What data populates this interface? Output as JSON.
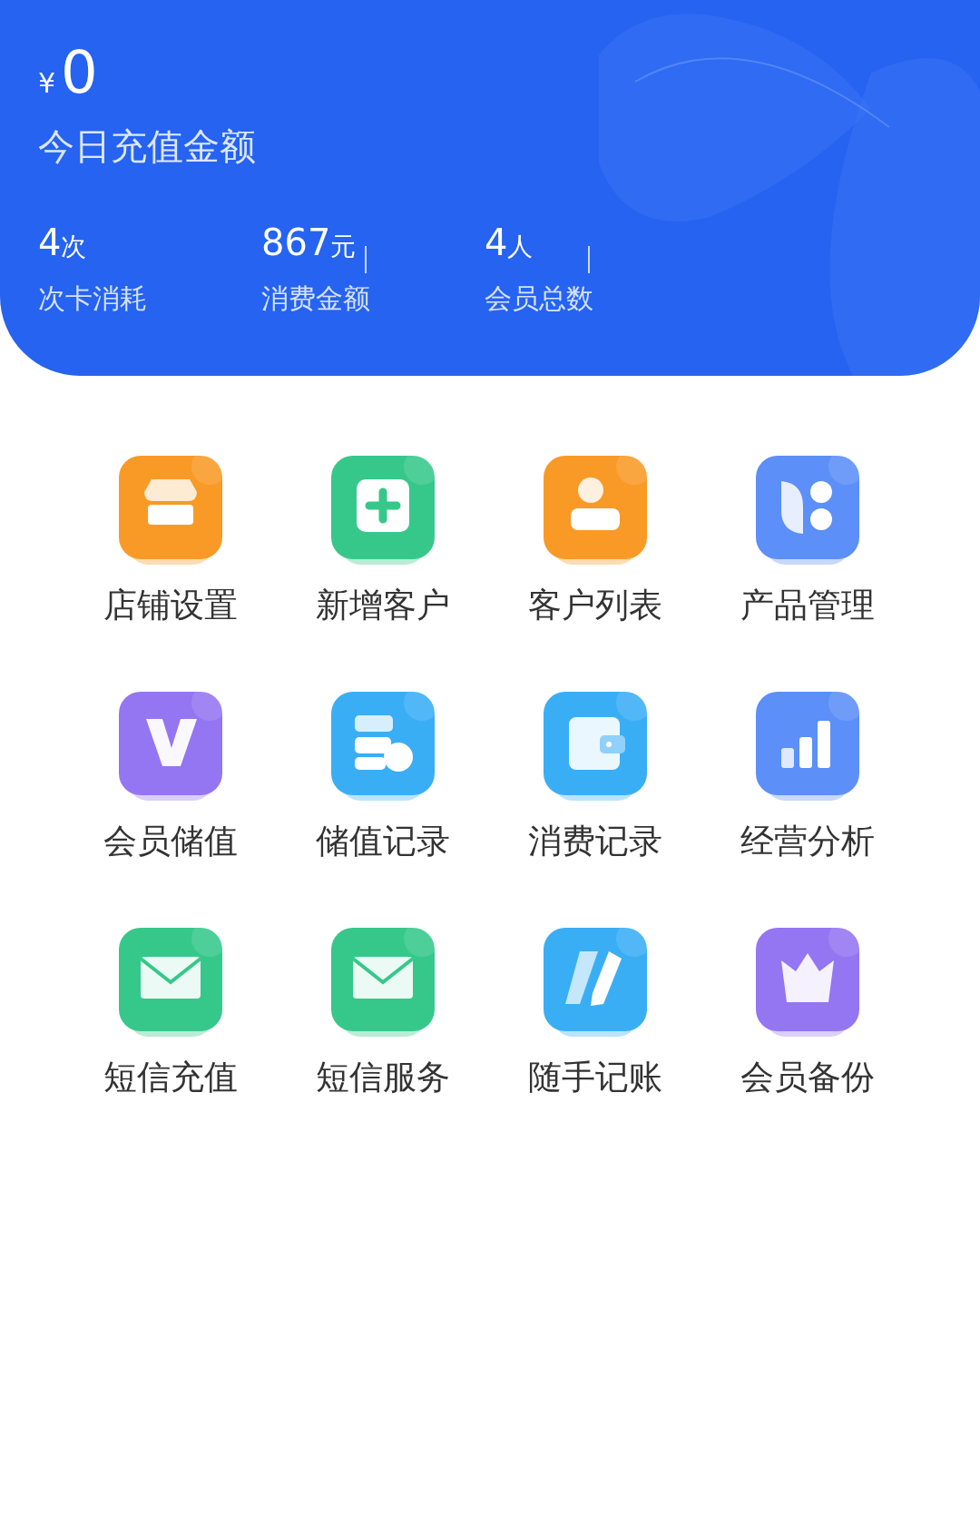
{
  "summary": {
    "currency": "¥",
    "amount": "0",
    "label": "今日充值金额",
    "stats": [
      {
        "value": "4",
        "unit": "次",
        "label": "次卡消耗"
      },
      {
        "value": "867",
        "unit": "元",
        "label": "消费金额"
      },
      {
        "value": "4",
        "unit": "人",
        "label": "会员总数"
      }
    ]
  },
  "menu": [
    {
      "label": "店铺设置",
      "kind": "store",
      "color": "#f99a26"
    },
    {
      "label": "新增客户",
      "kind": "add",
      "color": "#36c88a"
    },
    {
      "label": "客户列表",
      "kind": "user",
      "color": "#f99a26"
    },
    {
      "label": "产品管理",
      "kind": "apps",
      "color": "#5c8ff7"
    },
    {
      "label": "会员储值",
      "kind": "vip",
      "color": "#9475f2"
    },
    {
      "label": "储值记录",
      "kind": "stack",
      "color": "#3aaef5"
    },
    {
      "label": "消费记录",
      "kind": "wallet",
      "color": "#3aaef5"
    },
    {
      "label": "经营分析",
      "kind": "chart",
      "color": "#5c8ff7"
    },
    {
      "label": "短信充值",
      "kind": "mail",
      "color": "#36c88a"
    },
    {
      "label": "短信服务",
      "kind": "mail",
      "color": "#36c88a"
    },
    {
      "label": "随手记账",
      "kind": "pen",
      "color": "#3aaef5"
    },
    {
      "label": "会员备份",
      "kind": "crown",
      "color": "#9475f2"
    }
  ]
}
